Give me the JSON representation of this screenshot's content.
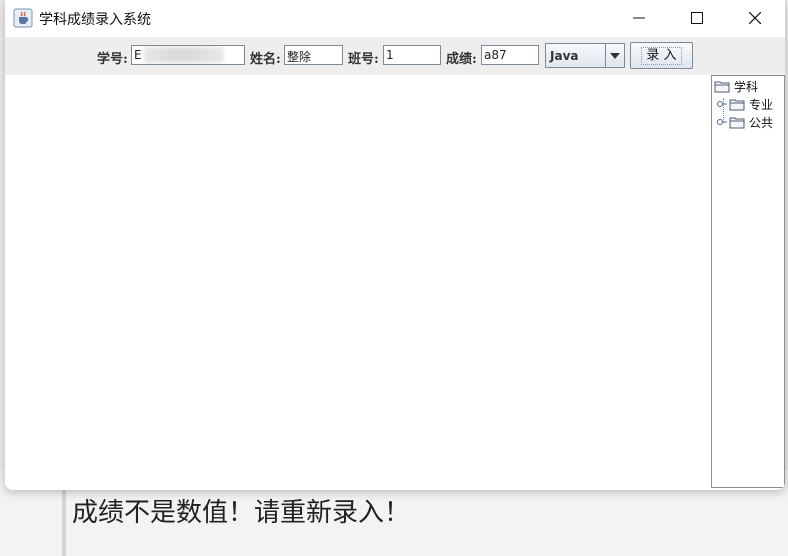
{
  "window": {
    "title": "学科成绩录入系统",
    "controls": [
      "minimize",
      "maximize",
      "close"
    ]
  },
  "form": {
    "student_id_label": "学号:",
    "student_id_value": "E",
    "name_label": "姓名:",
    "name_value": "整除",
    "class_label": "班号:",
    "class_value": "1",
    "score_label": "成绩:",
    "score_value": "a87",
    "subject_selected": "Java",
    "submit_label": "录 入"
  },
  "tree": {
    "root": "学科",
    "children": [
      "专业",
      "公共"
    ]
  },
  "message": {
    "error": "成绩不是数值！请重新录入！"
  },
  "icons": {
    "app": "java-cup-icon",
    "folder": "folder-icon"
  }
}
